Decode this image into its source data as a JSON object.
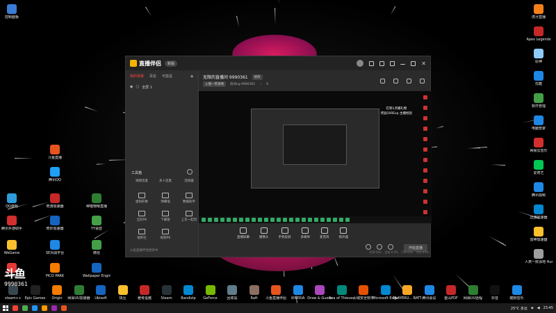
{
  "colors": {
    "accent": "#f44336",
    "brand": "#f4b400"
  },
  "desktop_left": [
    {
      "label": "控制面板",
      "icon": "control-panel-icon",
      "color": "#3a7bd5"
    },
    {
      "label": "斗鱼直播",
      "icon": "douyu-icon",
      "color": "#e8541e"
    },
    {
      "label": "腾讯QQ",
      "icon": "qq-icon",
      "color": "#1ea0f5"
    },
    {
      "label": "QQ游戏",
      "icon": "qq-game-icon",
      "color": "#2d9cdb"
    },
    {
      "label": "奇游加速器",
      "icon": "qiyou-icon",
      "color": "#c62828"
    },
    {
      "label": "种植物嗯直播",
      "icon": "plant-icon",
      "color": "#2e7d32"
    },
    {
      "label": "腾讯手游助手",
      "icon": "tencent-assistant-icon",
      "color": "#d32f2f"
    },
    {
      "label": "奇妙加速器",
      "icon": "qimiao-icon",
      "color": "#1565c0"
    },
    {
      "label": "YY语音",
      "icon": "yy-icon",
      "color": "#43a047"
    },
    {
      "label": "WeGame",
      "icon": "wegame-icon",
      "color": "#fbc02d"
    },
    {
      "label": "SE对战平台",
      "icon": "se-platform-icon",
      "color": "#1e88e5"
    },
    {
      "label": "微信",
      "icon": "wechat-icon",
      "color": "#43a047"
    },
    {
      "label": "EV录屏",
      "icon": "ev-icon",
      "color": "#e53935"
    },
    {
      "label": "PICO PARK",
      "icon": "pico-park-icon",
      "color": "#f57c00"
    },
    {
      "label": "Wallpaper Engine:",
      "icon": "wallpaper-engine-icon",
      "color": "#1565c0"
    }
  ],
  "desktop_right": [
    {
      "label": "虎牙直播",
      "icon": "huya-icon",
      "color": "#f57f17"
    },
    {
      "label": "Apex Legends",
      "icon": "apex-icon",
      "color": "#c62828"
    },
    {
      "label": "原神",
      "icon": "genshin-icon",
      "color": "#90caf9"
    },
    {
      "label": "优酷",
      "icon": "youku-icon",
      "color": "#1e88e5"
    },
    {
      "label": "软件管理",
      "icon": "software-manager-icon",
      "color": "#43a047"
    },
    {
      "label": "电脑管家",
      "icon": "pc-manager-icon",
      "color": "#1e88e5"
    },
    {
      "label": "网易云音乐",
      "icon": "netease-music-icon",
      "color": "#d32f2f"
    },
    {
      "label": "爱奇艺",
      "icon": "iqiyi-icon",
      "color": "#00c853"
    },
    {
      "label": "腾讯视频",
      "icon": "tencent-video-icon",
      "color": "#1e88e5"
    },
    {
      "label": "迅游加速器",
      "icon": "xunyou-icon",
      "color": "#0288d1"
    },
    {
      "label": "雷神加速器",
      "icon": "leishen-icon",
      "color": "#fbc02d"
    },
    {
      "label": "人类一败涂地 Human Fa...",
      "icon": "human-fall-flat-icon",
      "color": "#9e9e9e"
    }
  ],
  "desktop_bottom": [
    {
      "label": "steam++",
      "color": "#37474f"
    },
    {
      "label": "Epic Games",
      "color": "#212121"
    },
    {
      "label": "Origin",
      "color": "#f57c00"
    },
    {
      "label": "网易UU加速器",
      "color": "#2e7d32"
    },
    {
      "label": "Ubisoft",
      "color": "#1565c0"
    },
    {
      "label": "快压",
      "color": "#fbc02d"
    },
    {
      "label": "雅考蛋酱",
      "color": "#c62828"
    },
    {
      "label": "Steam",
      "color": "#263238"
    },
    {
      "label": "Bandizip",
      "color": "#0288d1"
    },
    {
      "label": "GeForce",
      "color": "#76b900"
    },
    {
      "label": "回收站",
      "color": "#607d8b"
    },
    {
      "label": "Raft",
      "color": "#8d6e63"
    },
    {
      "label": "斗鱼直播伴侣",
      "color": "#e8541e"
    },
    {
      "label": "XIBERIA",
      "color": "#1e88e5"
    },
    {
      "label": "Draw & Guess",
      "color": "#ab47bc"
    },
    {
      "label": "Sea of Thieves",
      "color": "#00897b"
    },
    {
      "label": "火绒安全软件",
      "color": "#e65100"
    },
    {
      "label": "Microsoft Edge",
      "color": "#0288d1"
    },
    {
      "label": "PLAYERU... BATTLEGR...",
      "color": "#f9a825"
    },
    {
      "label": "腾讯会议",
      "color": "#1e88e5"
    },
    {
      "label": "金山PDF",
      "color": "#c62828"
    },
    {
      "label": "网易UU远程",
      "color": "#2e7d32"
    },
    {
      "label": "抖音",
      "color": "#111111"
    },
    {
      "label": "酷狗音乐",
      "color": "#1e88e5"
    }
  ],
  "app": {
    "name": "直播伴侣",
    "version_pill": "新版",
    "sidebar_tabs": [
      "我的场景",
      "百名",
      "可能是"
    ],
    "scene_name": "全屏 1",
    "tools_title": "工具箱",
    "tools": [
      {
        "label": "视频连麦",
        "icon": "video-link-icon"
      },
      {
        "label": "多人连麦",
        "icon": "multi-link-icon"
      },
      {
        "label": "连接器",
        "icon": "connector-icon"
      },
      {
        "label": "虚拟形象",
        "icon": "avatar-icon"
      },
      {
        "label": "弹幕墙",
        "icon": "danmaku-icon"
      },
      {
        "label": "数据助手",
        "icon": "data-assistant-icon"
      },
      {
        "label": "全民PK",
        "icon": "pk-icon"
      },
      {
        "label": "下载管",
        "icon": "download-icon"
      },
      {
        "label": "上车一起玩",
        "icon": "ride-icon"
      },
      {
        "label": "福利社",
        "icon": "welfare-icon"
      },
      {
        "label": "视频PK",
        "icon": "video-pk-icon"
      }
    ],
    "footer_text": "斗鱼直播伴侣更新中",
    "room_title": "无限的直播间 9990361",
    "edit_label": "修改",
    "category": "入侵一笑涂地",
    "room_id_label": "房间ng 9990361",
    "like_count": "0",
    "gift_text": [
      "在到1点播礼物",
      "奖励100Exp 主播经验"
    ],
    "controls": [
      {
        "label": "直播屏幕",
        "icon": "screen-icon"
      },
      {
        "label": "摄像头",
        "icon": "camera-icon"
      },
      {
        "label": "手机投屏",
        "icon": "phone-cast-icon"
      },
      {
        "label": "多媒体",
        "icon": "media-icon"
      },
      {
        "label": "麦克风",
        "icon": "mic-icon"
      },
      {
        "label": "扬声器",
        "icon": "speaker-icon"
      }
    ],
    "start_button": "开始直播",
    "stats": [
      "码率:0kb",
      "丢帧:0.0%",
      "CPU:6%",
      "内存:45%"
    ]
  },
  "watermark": {
    "brand": "斗鱼",
    "room": "9990361"
  },
  "taskbar": {
    "weather": "25°C 多云",
    "time": "23:45",
    "apps": [
      "#f44336",
      "#4caf50",
      "#2196f3",
      "#ff9800",
      "#9c27b0",
      "#e8541e"
    ]
  }
}
